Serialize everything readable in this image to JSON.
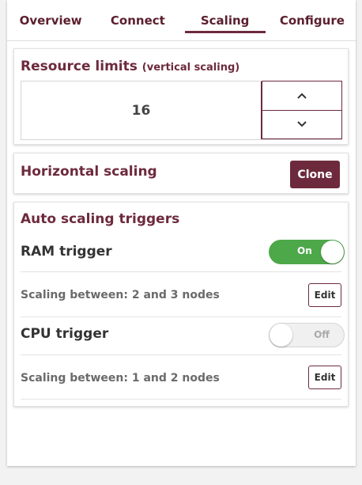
{
  "tabs": [
    {
      "label": "Overview"
    },
    {
      "label": "Connect"
    },
    {
      "label": "Scaling"
    },
    {
      "label": "Configure"
    }
  ],
  "resource_limits": {
    "title": "Resource limits",
    "subtitle": "(vertical scaling)",
    "value": "16"
  },
  "horizontal": {
    "title": "Horizontal scaling",
    "clone_label": "Clone"
  },
  "auto": {
    "title": "Auto scaling triggers",
    "triggers": [
      {
        "name": "RAM trigger",
        "state": "On",
        "enabled": true,
        "range": "Scaling between: 2 and 3 nodes",
        "edit_label": "Edit"
      },
      {
        "name": "CPU trigger",
        "state": "Off",
        "enabled": false,
        "range": "Scaling between: 1 and 2 nodes",
        "edit_label": "Edit"
      }
    ]
  },
  "colors": {
    "accent": "#6d2a3d",
    "toggle_on": "#4da84a"
  }
}
